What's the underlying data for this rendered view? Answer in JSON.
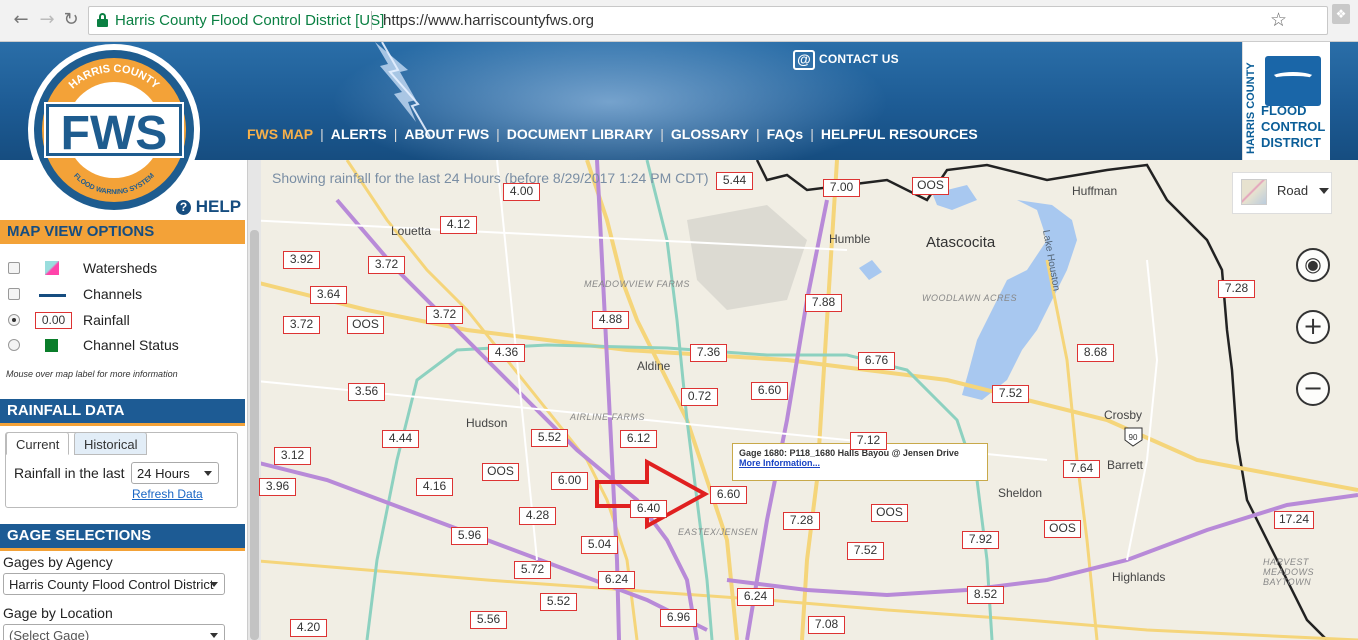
{
  "browser": {
    "site_identity": "Harris County Flood Control District [US]",
    "url": "https://www.harriscountyfws.org"
  },
  "header": {
    "logo_text": "FWS",
    "logo_ring_top": "HARRIS COUNTY",
    "logo_ring_bottom": "FLOOD WARNING SYSTEM",
    "contact_label": "CONTACT US",
    "nav": [
      "FWS MAP",
      "ALERTS",
      "ABOUT FWS",
      "DOCUMENT LIBRARY",
      "GLOSSARY",
      "FAQs",
      "HELPFUL RESOURCES"
    ],
    "district_vertical": "HARRIS COUNTY",
    "district_lines": [
      "FLOOD",
      "CONTROL",
      "DISTRICT"
    ]
  },
  "left_panel": {
    "help_label": "HELP",
    "map_view_title": "MAP VIEW OPTIONS",
    "options": [
      {
        "label": "Watersheds",
        "legend": "watershed"
      },
      {
        "label": "Channels",
        "legend": "channel"
      },
      {
        "label": "Rainfall",
        "legend": "rainfall",
        "legend_value": "0.00"
      },
      {
        "label": "Channel Status",
        "legend": "status"
      }
    ],
    "hint": "Mouse over map label for more information",
    "rainfall_title": "RAINFALL DATA",
    "tab_current": "Current",
    "tab_historical": "Historical",
    "rainfall_in_last_label": "Rainfall in the last",
    "rainfall_period": "24 Hours",
    "refresh_label": "Refresh Data",
    "gage_title": "GAGE SELECTIONS",
    "gages_by_agency_label": "Gages by Agency",
    "agency_value": "Harris County Flood Control District",
    "gage_by_location_label": "Gage by Location",
    "location_placeholder": "(Select Gage)"
  },
  "map": {
    "caption": "Showing rainfall for the last 24 Hours (before 8/29/2017 1:24 PM CDT)",
    "map_type": "Road",
    "places": [
      {
        "name": "Louetta",
        "style": "normal"
      },
      {
        "name": "Humble",
        "style": "normal"
      },
      {
        "name": "Atascocita",
        "style": "big"
      },
      {
        "name": "Huffman",
        "style": "normal"
      },
      {
        "name": "MEADOWVIEW FARMS",
        "style": "small"
      },
      {
        "name": "WOODLAWN ACRES",
        "style": "small"
      },
      {
        "name": "Aldine",
        "style": "normal"
      },
      {
        "name": "Hudson",
        "style": "normal"
      },
      {
        "name": "AIRLINE FARMS",
        "style": "small"
      },
      {
        "name": "Crosby",
        "style": "normal"
      },
      {
        "name": "Barrett",
        "style": "normal"
      },
      {
        "name": "Sheldon",
        "style": "normal"
      },
      {
        "name": "EASTEX/JENSEN",
        "style": "small"
      },
      {
        "name": "Highlands",
        "style": "normal"
      },
      {
        "name": "HARVEST MEADOWS BAYTOWN",
        "style": "small"
      },
      {
        "name": "Lake Houston",
        "style": "lake"
      }
    ],
    "gages": [
      "4.00",
      "5.44",
      "7.00",
      "OOS",
      "4.12",
      "3.92",
      "3.72",
      "3.64",
      "7.88",
      "7.28",
      "3.72",
      "OOS",
      "3.72",
      "4.88",
      "4.36",
      "7.36",
      "6.76",
      "8.68",
      "3.56",
      "0.72",
      "6.60",
      "7.52",
      "4.44",
      "5.52",
      "6.12",
      "7.12",
      "3.12",
      "OOS",
      "6.00",
      "7.64",
      "3.96",
      "4.16",
      "4.28",
      "6.40",
      "6.60",
      "7.28",
      "OOS",
      "5.96",
      "5.04",
      "7.52",
      "7.92",
      "OOS",
      "17.24",
      "5.72",
      "6.24",
      "5.52",
      "6.24",
      "8.52",
      "4.20",
      "5.56",
      "6.96",
      "7.08"
    ],
    "tooltip_title": "Gage 1680: P118_1680 Halls Bayou @ Jensen Drive",
    "tooltip_link": "More Information..."
  }
}
